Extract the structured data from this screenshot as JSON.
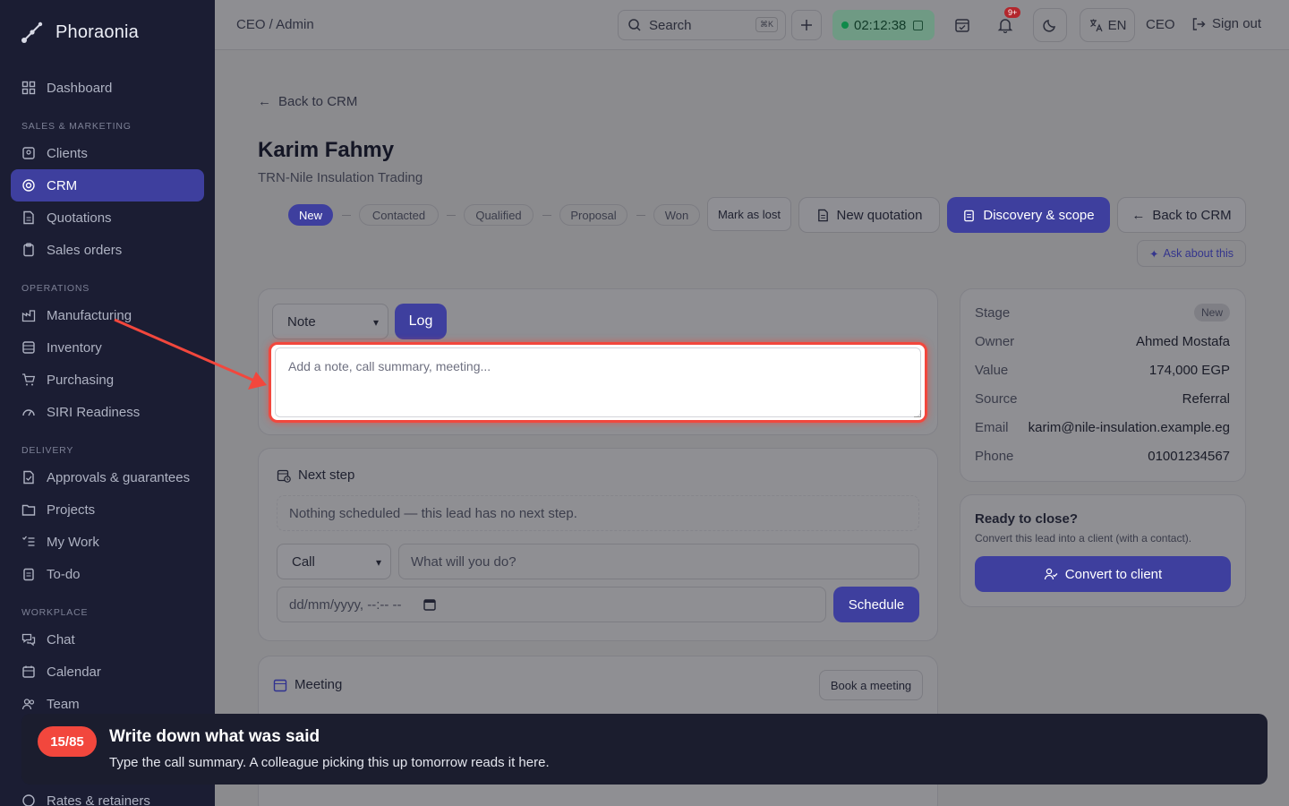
{
  "app": {
    "name": "Phoraonia"
  },
  "sidebar": {
    "items": [
      {
        "label": "Dashboard",
        "icon": "dashboard-icon"
      },
      {
        "label": "Clients",
        "icon": "clients-icon"
      },
      {
        "label": "CRM",
        "icon": "crm-icon",
        "active": true
      },
      {
        "label": "Quotations",
        "icon": "document-icon"
      },
      {
        "label": "Sales orders",
        "icon": "clipboard-icon"
      },
      {
        "label": "Manufacturing",
        "icon": "factory-icon"
      },
      {
        "label": "Inventory",
        "icon": "inventory-icon"
      },
      {
        "label": "Purchasing",
        "icon": "cart-icon"
      },
      {
        "label": "SIRI Readiness",
        "icon": "gauge-icon"
      },
      {
        "label": "Approvals & guarantees",
        "icon": "approval-icon"
      },
      {
        "label": "Projects",
        "icon": "folder-icon"
      },
      {
        "label": "My Work",
        "icon": "checklist-icon"
      },
      {
        "label": "To-do",
        "icon": "todo-icon"
      },
      {
        "label": "Chat",
        "icon": "chat-icon"
      },
      {
        "label": "Calendar",
        "icon": "calendar-icon"
      },
      {
        "label": "Team",
        "icon": "team-icon"
      },
      {
        "label": "Rates & retainers",
        "icon": "rates-icon"
      }
    ],
    "sections": [
      "SALES & MARKETING",
      "OPERATIONS",
      "DELIVERY",
      "WORKPLACE"
    ]
  },
  "topbar": {
    "breadcrumb": "CEO / Admin",
    "search_placeholder": "Search",
    "search_shortcut": "⌘K",
    "timer": "02:12:38",
    "notifications_badge": "9+",
    "language": "EN",
    "role": "CEO",
    "signout": "Sign out"
  },
  "lead": {
    "back_label": "Back to CRM",
    "name": "Karim Fahmy",
    "company": "TRN-Nile Insulation Trading",
    "stages": [
      "New",
      "Contacted",
      "Qualified",
      "Proposal",
      "Won"
    ],
    "active_stage": "New",
    "mark_lost": "Mark as lost",
    "new_quotation": "New quotation",
    "discovery": "Discovery & scope",
    "back_crm": "Back to CRM",
    "ask": "Ask about this"
  },
  "log": {
    "type_value": "Note",
    "log_button": "Log",
    "placeholder": "Add a note, call summary, meeting..."
  },
  "next_step": {
    "title": "Next step",
    "empty": "Nothing scheduled — this lead has no next step.",
    "type_value": "Call",
    "what_placeholder": "What will you do?",
    "date_placeholder": "dd/mm/yyyy, --:-- --",
    "schedule_button": "Schedule"
  },
  "meeting": {
    "title": "Meeting",
    "book_button": "Book a meeting"
  },
  "details": {
    "stage_label": "Stage",
    "stage_value": "New",
    "owner_label": "Owner",
    "owner_value": "Ahmed Mostafa",
    "value_label": "Value",
    "value_value": "174,000 EGP",
    "source_label": "Source",
    "source_value": "Referral",
    "email_label": "Email",
    "email_value": "karim@nile-insulation.example.eg",
    "phone_label": "Phone",
    "phone_value": "01001234567"
  },
  "close": {
    "title": "Ready to close?",
    "subtitle": "Convert this lead into a client (with a contact).",
    "button": "Convert to client"
  },
  "tour": {
    "step": "15/85",
    "title": "Write down what was said",
    "body": "Type the call summary. A colleague picking this up tomorrow reads it here."
  },
  "colors": {
    "accent": "#3e3f9e",
    "highlight": "#f2473d",
    "sidebar": "#1b1d33"
  }
}
